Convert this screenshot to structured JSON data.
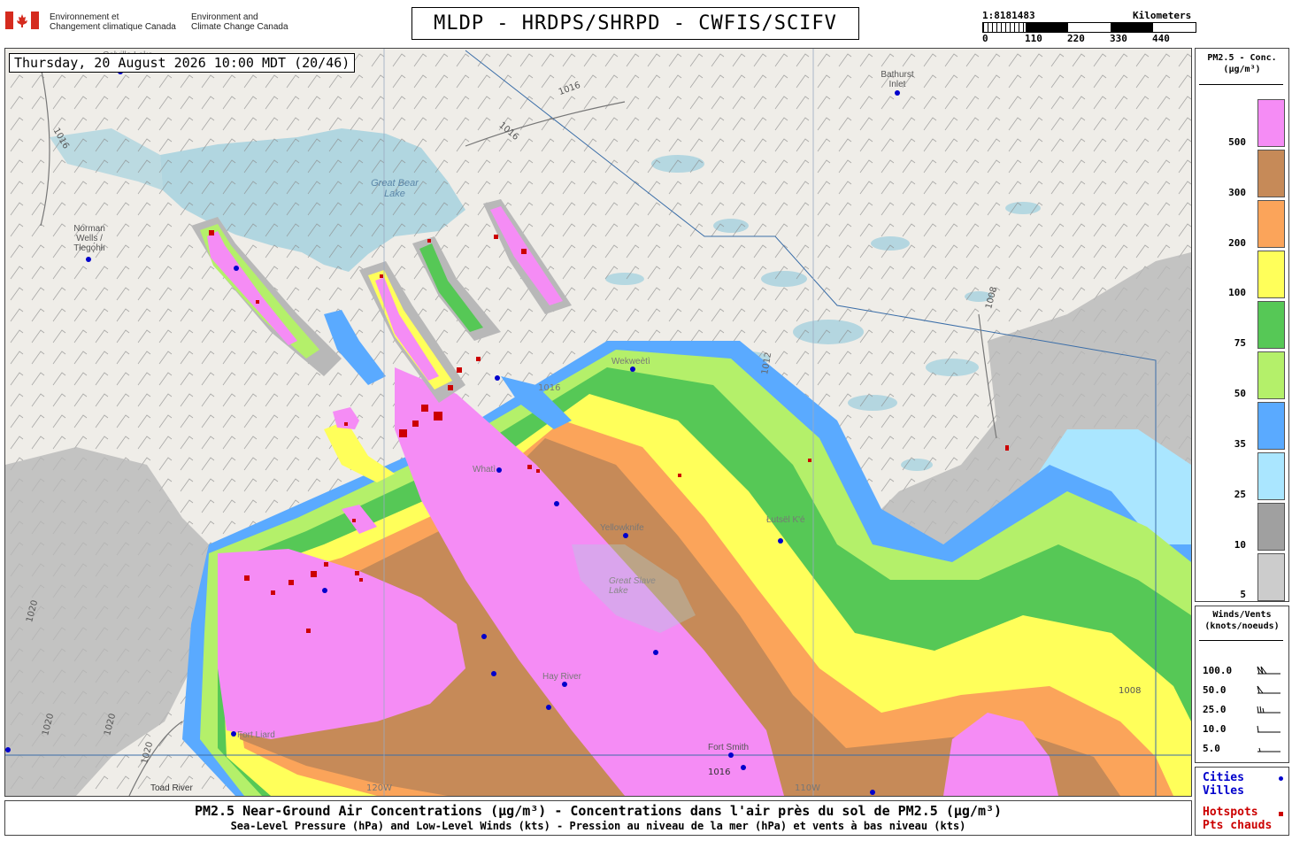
{
  "header": {
    "gov_fr_line1": "Environnement et",
    "gov_fr_line2": "Changement climatique Canada",
    "gov_en_line1": "Environment and",
    "gov_en_line2": "Climate Change Canada",
    "product_title": "MLDP - HRDPS/SHRPD - CWFIS/SCIFV",
    "flag_color": "#d52b1e"
  },
  "scale": {
    "ratio": "1:8181483",
    "unit": "Kilometers",
    "ticks": [
      "0",
      "110",
      "220",
      "330",
      "440"
    ]
  },
  "map": {
    "timestamp": "Thursday, 20 August 2026 10:00 MDT (20/46)",
    "place_labels": [
      "Bathurst Inlet",
      "Great Bear Lake",
      "Norman Wells / Tłegǫ́hłı",
      "Wekweètì",
      "Whatì",
      "Yellowknife",
      "Great Slave Lake",
      "Łutsël K'é",
      "Hay River",
      "Fort Smith",
      "Fort Liard",
      "Toad River",
      "Colville Lake"
    ],
    "isobar_labels": [
      "1016",
      "1016",
      "1016",
      "1016",
      "1012",
      "1008",
      "1008",
      "1016",
      "1020",
      "1020",
      "1020",
      "1020"
    ],
    "longitude_labels": [
      "120W",
      "110W"
    ],
    "city_color": "#0000cc",
    "hotspot_color": "#cc0000"
  },
  "legend": {
    "title_line1": "PM2.5 - Conc.",
    "title_line2": "(µg/m³)",
    "classes": [
      {
        "label": "500",
        "color": "#f58cf5"
      },
      {
        "label": "300",
        "color": "#c68a58"
      },
      {
        "label": "200",
        "color": "#fba45a"
      },
      {
        "label": "100",
        "color": "#ffff5a"
      },
      {
        "label": "75",
        "color": "#56c856"
      },
      {
        "label": "50",
        "color": "#b4f06a"
      },
      {
        "label": "35",
        "color": "#5aaaff"
      },
      {
        "label": "25",
        "color": "#aae6ff"
      },
      {
        "label": "10",
        "color": "#a0a0a0"
      },
      {
        "label": "5",
        "color": "#cccccc"
      }
    ]
  },
  "winds": {
    "title_line1": "Winds/Vents",
    "title_line2": "(knots/noeuds)",
    "rows": [
      "100.0",
      "50.0",
      "25.0",
      "10.0",
      "5.0"
    ]
  },
  "markers": {
    "cities_en": "Cities",
    "cities_fr": "Villes",
    "hotspots_en": "Hotspots",
    "hotspots_fr": "Pts chauds",
    "city_color": "#0000cc",
    "hotspot_color": "#cc0000"
  },
  "footer": {
    "line1": "PM2.5 Near-Ground Air Concentrations (µg/m³) - Concentrations dans l'air près du sol de PM2.5 (µg/m³)",
    "line2": "Sea-Level Pressure (hPa) and Low-Level Winds (kts) - Pression au niveau de la mer (hPa) et vents à bas niveau (kts)"
  }
}
